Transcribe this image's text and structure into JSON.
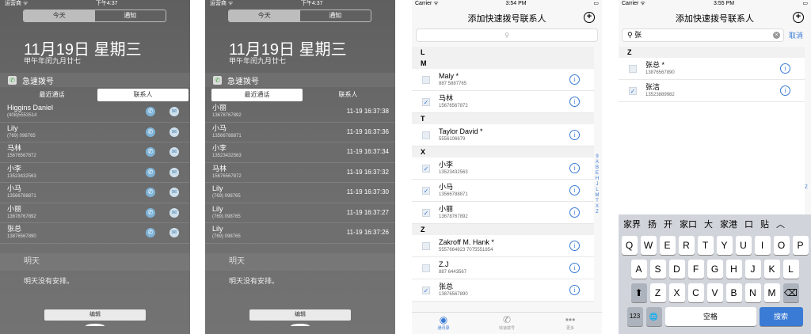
{
  "nc1": {
    "status_left": "运营商 ᯤ",
    "status_time": "下午4:37",
    "seg_today": "今天",
    "seg_notify": "通知",
    "date": "11月19日 星期三",
    "lunar": "甲午年闰九月廿七",
    "widget_title": "急速拨号",
    "tab_recent": "最近通话",
    "tab_contacts": "联系人",
    "rows": [
      {
        "name": "Higgins Daniel",
        "phone": "(408)5553514"
      },
      {
        "name": "Lily",
        "phone": "(769) 098765"
      },
      {
        "name": "马林",
        "phone": "15676567872"
      },
      {
        "name": "小李",
        "phone": "13523432563"
      },
      {
        "name": "小马",
        "phone": "13566788871"
      },
      {
        "name": "小丽",
        "phone": "13678767892"
      },
      {
        "name": "张总",
        "phone": "13876567890"
      }
    ],
    "tomorrow": "明天",
    "no_events": "明天没有安排。",
    "edit": "编辑"
  },
  "nc2": {
    "status_left": "运营商 ᯤ",
    "status_time": "下午4:37",
    "seg_today": "今天",
    "seg_notify": "通知",
    "date": "11月19日 星期三",
    "lunar": "甲午年闰九月廿七",
    "widget_title": "急速拨号",
    "tab_recent": "最近通话",
    "tab_contacts": "联系人",
    "rows": [
      {
        "name": "小丽",
        "phone": "13678767892",
        "time": "11-19 16:37:38"
      },
      {
        "name": "小马",
        "phone": "13566788871",
        "time": "11-19 16:37:36"
      },
      {
        "name": "小李",
        "phone": "13523432563",
        "time": "11-19 16:37:34"
      },
      {
        "name": "马林",
        "phone": "15676567872",
        "time": "11-19 16:37:32"
      },
      {
        "name": "Lily",
        "phone": "(769) 098765",
        "time": "11-19 16:37:30"
      },
      {
        "name": "Lily",
        "phone": "(769) 098765",
        "time": "11-19 16:37:27"
      },
      {
        "name": "Lily",
        "phone": "(769) 098765",
        "time": "11-19 16:37:26"
      }
    ],
    "tomorrow": "明天",
    "no_events": "明天没有安排。",
    "edit": "编辑"
  },
  "ios3": {
    "status_left": "Carrier ᯤ",
    "status_time": "3:54 PM",
    "title": "添加快速拨号联系人",
    "plus": "+",
    "search_icon": "⚲",
    "sections": [
      {
        "letter": "L",
        "items": []
      },
      {
        "letter": "M",
        "items": [
          {
            "name": "Maly *",
            "phone": "887 5887765",
            "checked": false
          },
          {
            "name": "马林",
            "phone": "15676567872",
            "checked": true
          }
        ]
      },
      {
        "letter": "T",
        "items": [
          {
            "name": "Taylor  David *",
            "phone": "5556106679",
            "checked": false
          }
        ]
      },
      {
        "letter": "X",
        "items": [
          {
            "name": "小李",
            "phone": "13523432563",
            "checked": true
          },
          {
            "name": "小马",
            "phone": "13566788871",
            "checked": true
          },
          {
            "name": "小丽",
            "phone": "13678767892",
            "checked": true
          }
        ]
      },
      {
        "letter": "Z",
        "items": [
          {
            "name": "Zakroff M. Hank *",
            "phone": "5557664823  7075551854",
            "checked": false
          },
          {
            "name": "Z.J",
            "phone": "887 6443567",
            "checked": false
          },
          {
            "name": "张总",
            "phone": "13876567890",
            "checked": true
          }
        ]
      }
    ],
    "index": [
      "9",
      "A",
      "B",
      "E",
      "H",
      "J",
      "L",
      "M",
      "T",
      "X",
      "Z"
    ],
    "tabs": [
      {
        "icon": "◉",
        "label": "通讯录"
      },
      {
        "icon": "✆",
        "label": "快速拨号"
      },
      {
        "icon": "•••",
        "label": "更多"
      }
    ]
  },
  "ios4": {
    "status_left": "Carrier ᯤ",
    "status_time": "3:55 PM",
    "title": "添加快速拨号联系人",
    "plus": "+",
    "query": "张",
    "clear": "×",
    "cancel": "取消",
    "section": "Z",
    "items": [
      {
        "name": "张总 *",
        "phone": "13876567890",
        "checked": false
      },
      {
        "name": "张洁",
        "phone": "13523889982",
        "checked": true
      }
    ],
    "index_z": "Z",
    "suggestions": [
      "家界",
      "扬",
      "开",
      "家口",
      "大",
      "家港",
      "口",
      "贴",
      "︿"
    ],
    "keys_row1": [
      "Q",
      "W",
      "E",
      "R",
      "T",
      "Y",
      "U",
      "I",
      "O",
      "P"
    ],
    "keys_row2": [
      "A",
      "S",
      "D",
      "F",
      "G",
      "H",
      "J",
      "K",
      "L"
    ],
    "keys_row3": [
      "Z",
      "X",
      "C",
      "V",
      "B",
      "N",
      "M"
    ],
    "shift": "⬆",
    "backspace": "⌫",
    "num": "123",
    "globe": "🌐",
    "space": "空格",
    "search": "搜索"
  }
}
